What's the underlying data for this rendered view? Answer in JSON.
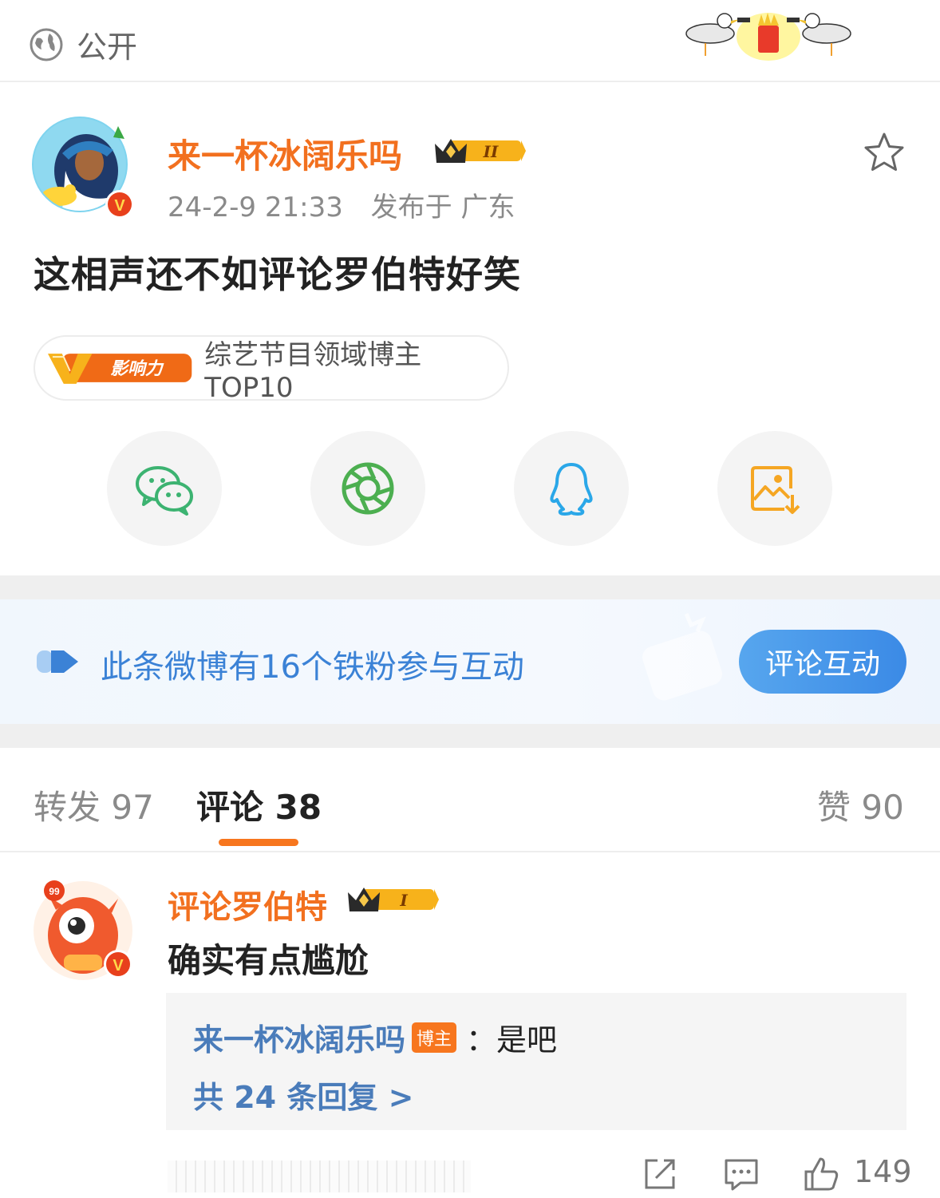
{
  "header": {
    "visibility_label": "公开"
  },
  "post": {
    "username": "来一杯冰阔乐吗",
    "level_badge": "II",
    "timestamp": "24-2-9 21:33",
    "location": "发布于 广东",
    "text": "这相声还不如评论罗伯特好笑",
    "influence_badge": "影响力",
    "influence_label": "综艺节目领域博主TOP10"
  },
  "share": {
    "items": [
      "wechat-icon",
      "moments-icon",
      "qq-icon",
      "save-image-icon"
    ]
  },
  "fans_banner": {
    "text": "此条微博有16个铁粉参与互动",
    "button_label": "评论互动"
  },
  "tabs": {
    "reposts": "转发 97",
    "comments": "评论 38",
    "likes": "赞 90"
  },
  "comment": {
    "username": "评论罗伯特",
    "level_badge": "I",
    "avatar_badge": "99",
    "text": "确实有点尴尬",
    "reply": {
      "username": "来一杯冰阔乐吗",
      "author_tag": "博主",
      "text": "：是吧",
      "more": "共 24 条回复 >"
    },
    "like_count": "149"
  },
  "colors": {
    "accent_orange": "#f2701f",
    "link_blue": "#4a7cba",
    "fans_blue": "#3b82d6"
  }
}
